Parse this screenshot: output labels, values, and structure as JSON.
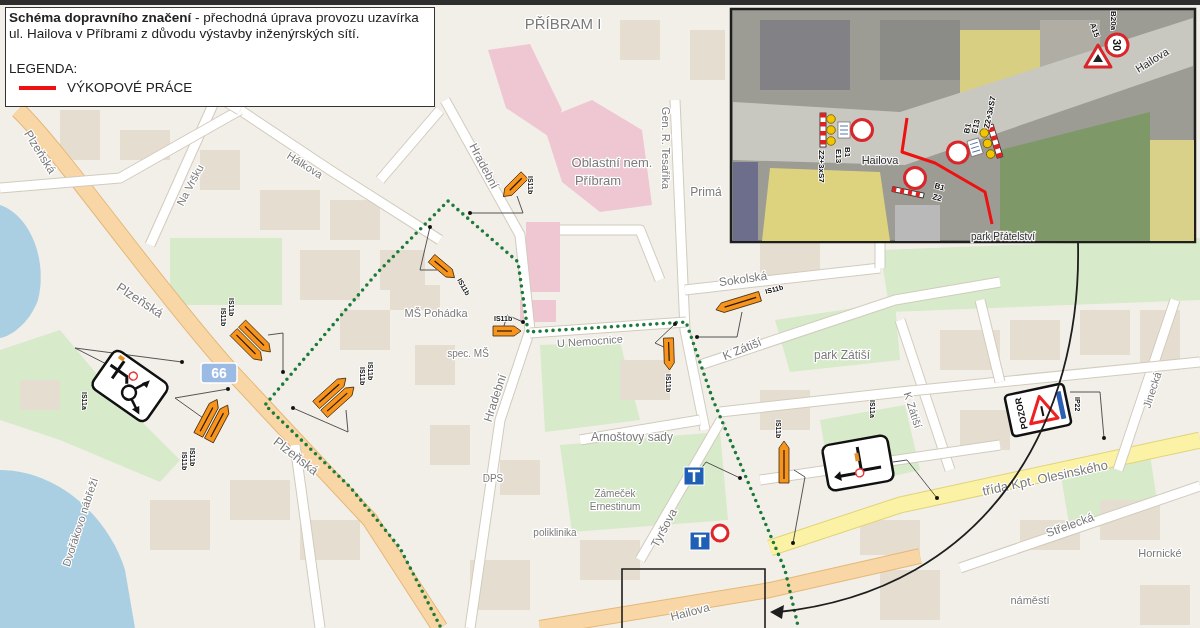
{
  "header": {
    "title": "**Schéma dopravního značení** - přechodná úprava provozu uzavírka ul. Hailova v Příbrami z důvodu výstavby inženýrských sítí.",
    "legend_title": "LEGENDA:",
    "legend": [
      {
        "label": "VÝKOPOVÉ PRÁCE",
        "color": "#ee1111"
      }
    ]
  },
  "map": {
    "road_number": "66",
    "labels": [
      "PŘÍBRAM I",
      "Oblastní nem.",
      "Příbram",
      "Plzeňská",
      "Plzeňská",
      "Plzeňská",
      "Hálkova",
      "Na Vršku",
      "Hradební",
      "Hradební",
      "MŠ Pohádka",
      "Sokolská",
      "K Zátiší",
      "K Zátiší",
      "park Zátiší",
      "Arnoštovy sady",
      "třída Kpt. Olesinského",
      "Střelecká",
      "Jinecká",
      "Tyršova",
      "Gen. R. Tesaříka",
      "Zámeček",
      "Ernestinum",
      "Dvořákovo nábřeží",
      "DPS",
      "spec. MŠ",
      "U Nemocnice",
      "Primá",
      "poliklinika",
      "Hailova",
      "Hornické",
      "náměstí"
    ],
    "signs": [
      {
        "kind": "roundabout-board",
        "codes": [
          "IS11a"
        ]
      },
      {
        "kind": "detour-pair",
        "codes": [
          "IS11b",
          "IS11b"
        ]
      },
      {
        "kind": "detour-pair",
        "codes": [
          "IS11b",
          "IS11b"
        ]
      },
      {
        "kind": "detour-pair",
        "codes": [
          "IS11b",
          "IS11b"
        ]
      },
      {
        "kind": "detour-arrow",
        "codes": [
          "IS11b"
        ]
      },
      {
        "kind": "detour-arrow",
        "codes": [
          "IS11b"
        ]
      },
      {
        "kind": "detour-arrow",
        "codes": [
          "IS11b"
        ]
      },
      {
        "kind": "detour-arrow",
        "codes": [
          "IS11b"
        ]
      },
      {
        "kind": "detour-arrow",
        "codes": [
          "IS11b"
        ]
      },
      {
        "kind": "detour-arrow",
        "codes": [
          "IS11b"
        ]
      },
      {
        "kind": "junction-board",
        "codes": [
          "IS11a"
        ]
      },
      {
        "kind": "warning-board",
        "text": "POZOR",
        "codes": [
          "IP22"
        ]
      },
      {
        "kind": "info-sign"
      },
      {
        "kind": "info-sign"
      },
      {
        "kind": "no-entry"
      }
    ]
  },
  "inset": {
    "labels": [
      "Hailova",
      "Hailova",
      "park Přátelství"
    ],
    "signs": [
      {
        "kind": "closure",
        "codes": [
          "B1",
          "E13",
          "Z2+3xS7"
        ]
      },
      {
        "kind": "closure",
        "codes": [
          "B1",
          "E13",
          "Z2+3xS7"
        ]
      },
      {
        "kind": "closure-short",
        "codes": [
          "B1",
          "Z2"
        ]
      },
      {
        "kind": "warning-triangle",
        "codes": [
          "A15"
        ]
      },
      {
        "kind": "speed-limit",
        "text": "30",
        "codes": [
          "B20a"
        ]
      }
    ]
  }
}
